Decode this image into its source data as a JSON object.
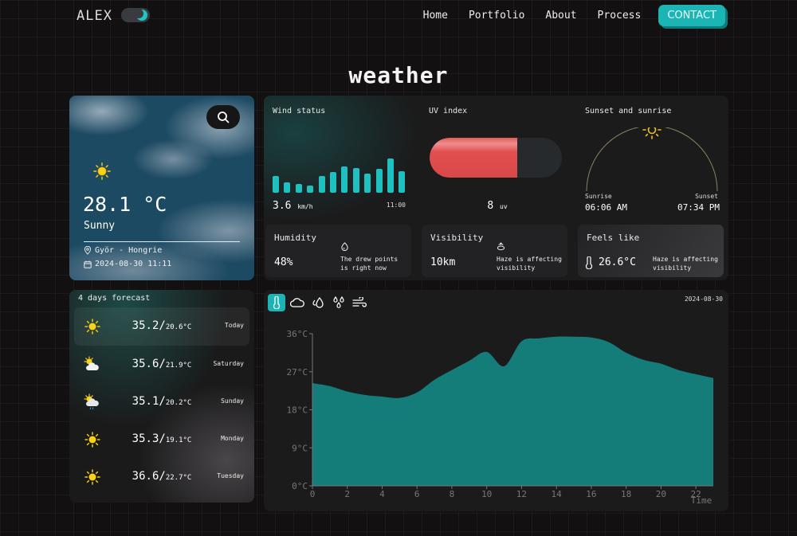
{
  "nav": {
    "logo": "ALEX",
    "theme_toggle": "dark",
    "links": [
      "Home",
      "Portfolio",
      "About",
      "Process"
    ],
    "contact_label": "CONTACT"
  },
  "page_title": "weather",
  "current": {
    "icon": "sun-icon",
    "temperature": "28.1 °C",
    "condition": "Sunny",
    "location": "Györ - Hongrie",
    "datetime": "2024-08-30 11:11"
  },
  "wind": {
    "title": "Wind status",
    "value": "3.6",
    "unit": "km/h",
    "time": "11:00",
    "bars": [
      5,
      3,
      2.5,
      2.2,
      5,
      6.2,
      7.8,
      7.4,
      5.7,
      7.1,
      10.2,
      6.4
    ]
  },
  "uv": {
    "title": "UV index",
    "value": "8",
    "unit": "uv",
    "fill_fraction": 0.66
  },
  "sun": {
    "title": "Sunset and sunrise",
    "sunrise_label": "Sunrise",
    "sunrise": "06:06 AM",
    "sunset_label": "Sunset",
    "sunset": "07:34 PM"
  },
  "humidity": {
    "title": "Humidity",
    "value": "48%",
    "note": "The drew points is right now"
  },
  "visibility": {
    "title": "Visibility",
    "value": "10km",
    "note": "Haze is affecting visibility"
  },
  "feels_like": {
    "title": "Feels like",
    "value": "26.6°C",
    "note": "Haze is affecting visibility"
  },
  "forecast": {
    "title": "4 days forecast",
    "days": [
      {
        "icon": "sun",
        "max": "35.2/",
        "min": "20.6°C",
        "day": "Today",
        "active": true
      },
      {
        "icon": "sun-cloud",
        "max": "35.6/",
        "min": "21.9°C",
        "day": "Saturday"
      },
      {
        "icon": "sun-cloud-rain",
        "max": "35.1/",
        "min": "20.2°C",
        "day": "Sunday"
      },
      {
        "icon": "sun",
        "max": "35.3/",
        "min": "19.1°C",
        "day": "Monday"
      },
      {
        "icon": "sun",
        "max": "36.6/",
        "min": "22.7°C",
        "day": "Tuesday"
      }
    ]
  },
  "chart_tabs": [
    "thermometer",
    "cloud",
    "humidity-drops",
    "rain-drops",
    "wind"
  ],
  "chart_date": "2024-08-30",
  "chart_data": {
    "type": "area",
    "title": "",
    "xlabel": "Time",
    "ylabel": "",
    "x": [
      0,
      1,
      2,
      3,
      4,
      5,
      6,
      7,
      8,
      9,
      10,
      11,
      12,
      13,
      14,
      15,
      16,
      17,
      18,
      19,
      20,
      21,
      22,
      23
    ],
    "values": [
      24.3,
      23.6,
      22.3,
      21.5,
      21.1,
      20.8,
      22.1,
      25.1,
      27.4,
      29.6,
      31.7,
      28.3,
      34.2,
      34.9,
      35.3,
      35.3,
      35.1,
      34.0,
      31.5,
      29.8,
      28.9,
      27.4,
      26.4,
      25.5
    ],
    "xlim": [
      0,
      23
    ],
    "ylim": [
      0,
      36
    ],
    "x_ticks": [
      "0",
      "2",
      "4",
      "6",
      "8",
      "10",
      "12",
      "14",
      "16",
      "18",
      "20",
      "22"
    ],
    "y_ticks": [
      "0°C",
      "9°C",
      "18°C",
      "27°C",
      "36°C"
    ],
    "fill_color": "#147d7a",
    "grid": false
  }
}
